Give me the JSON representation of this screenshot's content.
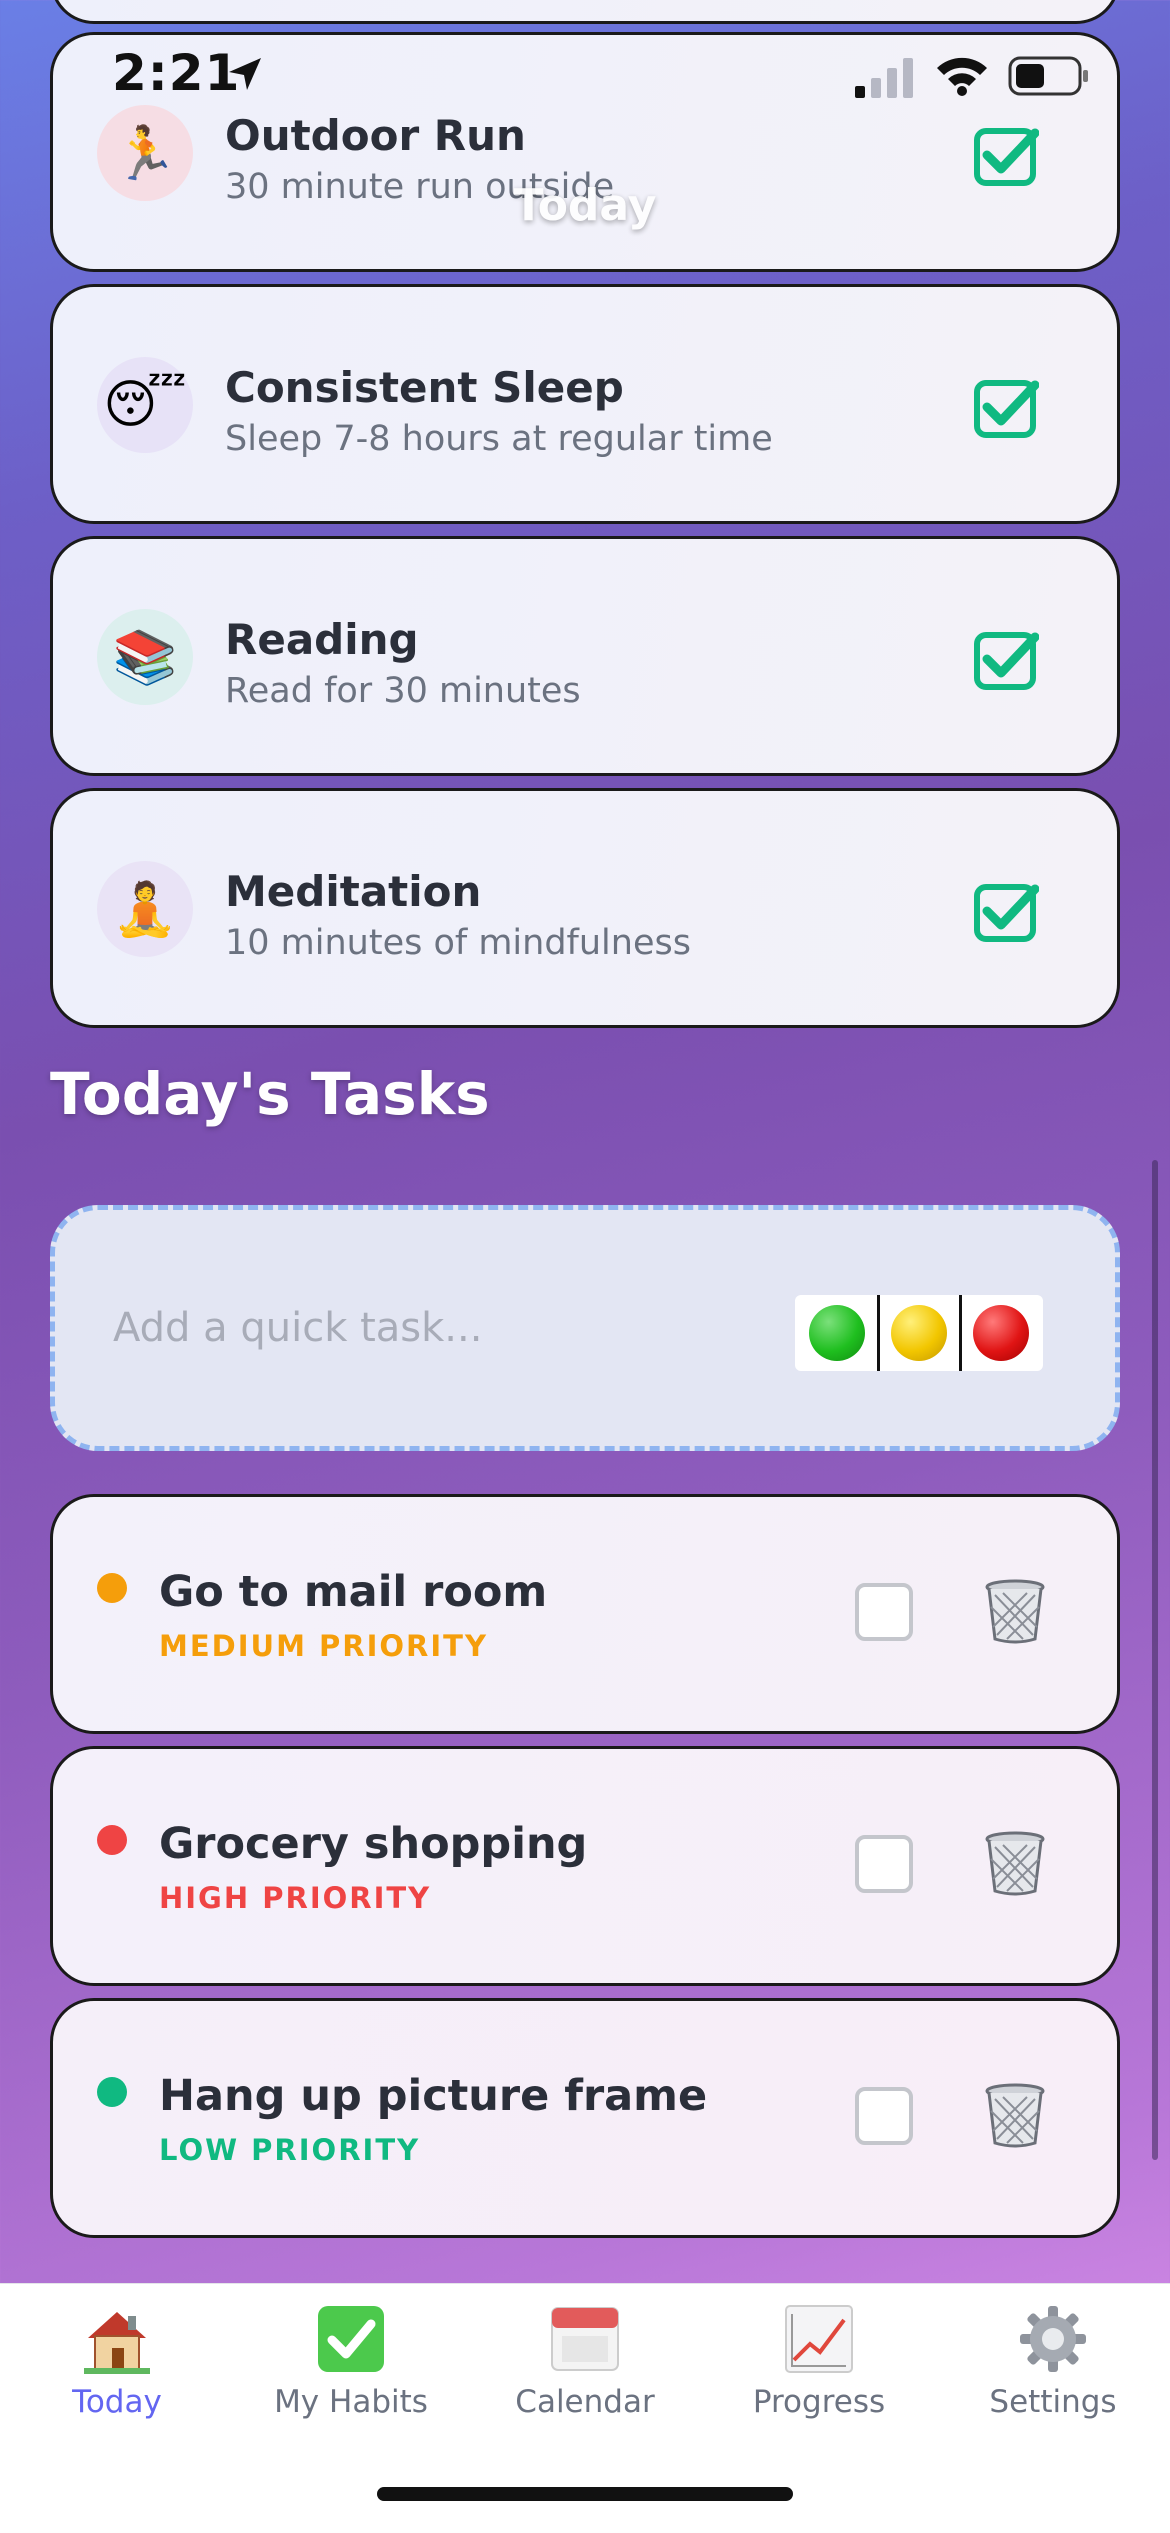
{
  "status_bar": {
    "time": "2:21"
  },
  "nav": {
    "title": "Today"
  },
  "habits": [
    {
      "icon": "🏃",
      "icon_name": "runner-icon",
      "icon_bg": "#f6dde4",
      "title": "Outdoor Run",
      "subtitle": "30 minute run outside",
      "completed": true
    },
    {
      "icon": "😴",
      "icon_name": "sleeping-face-icon",
      "icon_bg": "#e7e2f7",
      "title": "Consistent Sleep",
      "subtitle": "Sleep 7-8 hours at regular time",
      "completed": true
    },
    {
      "icon": "📚",
      "icon_name": "books-icon",
      "icon_bg": "#dcefee",
      "title": "Reading",
      "subtitle": "Read for 30 minutes",
      "completed": true
    },
    {
      "icon": "🧘",
      "icon_name": "meditation-icon",
      "icon_bg": "#e9e3f6",
      "title": "Meditation",
      "subtitle": "10 minutes of mindfulness",
      "completed": true
    }
  ],
  "tasks_section": {
    "title": "Today's Tasks"
  },
  "quick_task": {
    "placeholder": "Add a quick task...",
    "priority_colors": {
      "low": "#1fbf1f",
      "medium": "#f2c600",
      "high": "#e01414"
    }
  },
  "tasks": [
    {
      "title": "Go to mail room",
      "priority": "MEDIUM PRIORITY",
      "color": "#f59e0b",
      "completed": false
    },
    {
      "title": "Grocery shopping",
      "priority": "HIGH PRIORITY",
      "color": "#ef4444",
      "completed": false
    },
    {
      "title": "Hang up picture frame",
      "priority": "LOW PRIORITY",
      "color": "#10b981",
      "completed": false
    }
  ],
  "tab_bar": {
    "tabs": [
      {
        "label": "Today",
        "icon": "house-icon",
        "active": true
      },
      {
        "label": "My Habits",
        "icon": "checkmark-box-icon",
        "active": false
      },
      {
        "label": "Calendar",
        "icon": "calendar-icon",
        "active": false
      },
      {
        "label": "Progress",
        "icon": "chart-icon",
        "active": false
      },
      {
        "label": "Settings",
        "icon": "gear-icon",
        "active": false
      }
    ]
  },
  "colors": {
    "accent": "#6366f1",
    "check_green": "#10b981"
  }
}
